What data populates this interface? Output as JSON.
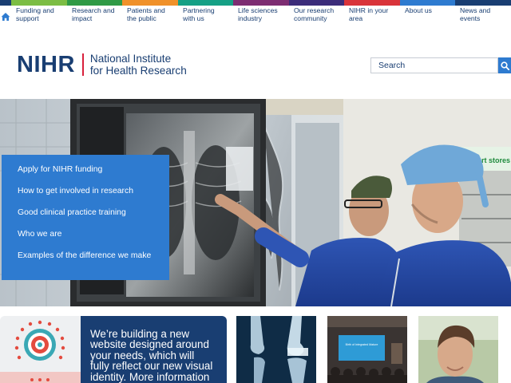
{
  "nav": {
    "home_color": "#193e72",
    "items": [
      {
        "line1": "Funding and",
        "line2": "support",
        "color": "#7cbd44"
      },
      {
        "line1": "Research and",
        "line2": "impact",
        "color": "#2f9a46"
      },
      {
        "line1": "Patients and",
        "line2": "the public",
        "color": "#f0912a"
      },
      {
        "line1": "Partnering",
        "line2": "with us",
        "color": "#15a085"
      },
      {
        "line1": "Life sciences",
        "line2": "industry",
        "color": "#7d2d72"
      },
      {
        "line1": "Our research",
        "line2": "community",
        "color": "#3b2c7a"
      },
      {
        "line1": "NIHR in your",
        "line2": "area",
        "color": "#d9343a"
      },
      {
        "line1": "About us",
        "line2": "",
        "color": "#2e7bd0"
      },
      {
        "line1": "News and",
        "line2": "events",
        "color": "#193e72"
      }
    ]
  },
  "brand": {
    "mark": "NIHR",
    "line1": "National Institute",
    "line2": "for Health Research",
    "accent_color": "#d8203c"
  },
  "search": {
    "placeholder": "Search",
    "button_icon": "search-icon",
    "button_color": "#2e7bd0"
  },
  "hero": {
    "links": [
      "Apply for NIHR funding",
      "How to get involved in research",
      "Good clinical practice training",
      "Who we are",
      "Examples of the difference we make"
    ],
    "sign_text": "smart stores"
  },
  "news": {
    "lines": [
      "We’re building a new",
      "website designed around",
      "your needs, which will",
      "fully reflect our new visual",
      "identity. More information"
    ]
  },
  "tiles": {
    "screen_text": "Birth of Integrated Mature"
  }
}
